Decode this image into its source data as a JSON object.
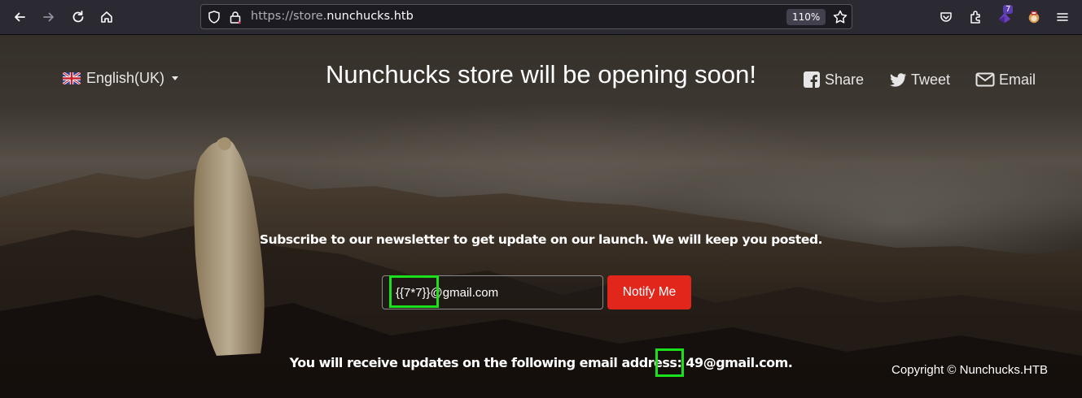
{
  "browser": {
    "url_prefix": "https://store.",
    "url_domain": "nunchucks.htb",
    "zoom": "110%",
    "extension_badge": "7",
    "icons": [
      "back-icon",
      "forward-icon",
      "reload-icon",
      "home-icon",
      "shield-icon",
      "lock-icon",
      "bookmark-star-icon",
      "pocket-icon",
      "extensions-icon",
      "extension-icon",
      "fox-extension-icon",
      "menu-icon"
    ]
  },
  "header": {
    "language": "English(UK)",
    "title": "Nunchucks store will be opening soon!",
    "share_label": "Share",
    "tweet_label": "Tweet",
    "email_label": "Email"
  },
  "newsletter": {
    "prompt": "Subscribe to our newsletter to get update on our launch. We will keep you posted.",
    "email_value": "{{7*7}}@gmail.com",
    "notify_label": "Notify Me",
    "result_prefix": "You will receive updates on the following email address: ",
    "result_value": "49",
    "result_suffix": "@gmail.com."
  },
  "footer": {
    "copyright": "Copyright © Nunchucks.HTB"
  },
  "colors": {
    "accent_button": "#e1261c",
    "highlight_box": "#1be01b"
  }
}
